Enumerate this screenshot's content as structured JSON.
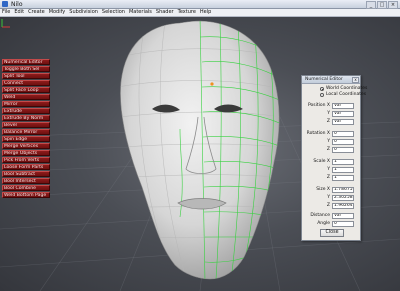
{
  "window": {
    "title": "Nilo",
    "min_glyph": "_",
    "max_glyph": "□",
    "close_glyph": "×"
  },
  "menu": [
    "File",
    "Edit",
    "Create",
    "Modify",
    "Subdivision",
    "Selection",
    "Materials",
    "Shader",
    "Texture",
    "Help"
  ],
  "commands": [
    "Numerical Editor",
    "Toggle Both Sel",
    "Split Tool",
    "Connect",
    "Split Face Loop",
    "Weld",
    "Mirror",
    "Extrude",
    "Extrude By Norm",
    "Bevel",
    "Balance Mirror",
    "Spin Edge",
    "Merge Vertices",
    "Merge Objects",
    "Pick From Verts",
    "Loose Form Parts",
    "Bool Subtract",
    "Bool Intersect",
    "Bool Combine",
    "Weld Bottom Page"
  ],
  "dialog": {
    "title": "Numerical Editor",
    "close_glyph": "x",
    "coords": [
      {
        "label": "World Coordinates",
        "selected": true
      },
      {
        "label": "Local Coordinates",
        "selected": false
      }
    ],
    "fields": [
      {
        "label": "Position X",
        "value": "Var"
      },
      {
        "label": "Y",
        "value": "Var"
      },
      {
        "label": "Z",
        "value": "Var"
      },
      {
        "label": "Rotation X",
        "value": "0"
      },
      {
        "label": "Y",
        "value": "0"
      },
      {
        "label": "Z",
        "value": "0"
      },
      {
        "label": "Scale X",
        "value": "1"
      },
      {
        "label": "Y",
        "value": "1"
      },
      {
        "label": "Z",
        "value": "1"
      },
      {
        "label": "Size X",
        "value": "1.78675m"
      },
      {
        "label": "Y",
        "value": "2.30258m"
      },
      {
        "label": "Z",
        "value": "1.96264m"
      },
      {
        "label": "Distance",
        "value": "Var"
      },
      {
        "label": "Angle",
        "value": "0"
      }
    ],
    "close_label": "Close"
  },
  "colors": {
    "accent_wire": "#37d13f",
    "command_red": "#7e1414",
    "viewport": "#4b4e55"
  }
}
